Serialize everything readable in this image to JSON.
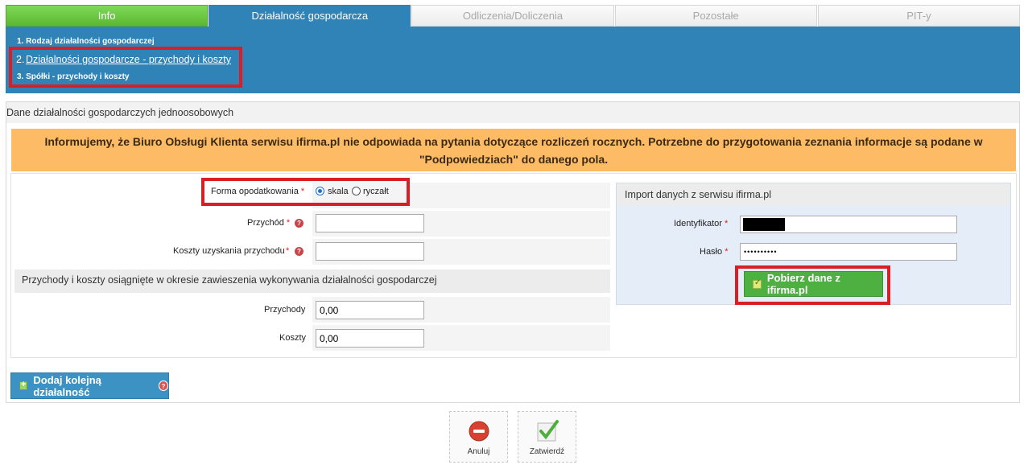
{
  "tabs": [
    "Info",
    "Działalność gospodarcza",
    "Odliczenia/Doliczenia",
    "Pozostałe",
    "PIT-y"
  ],
  "steps": {
    "s1": "1. Rodzaj działalności gospodarczej",
    "s2_num": "2.",
    "s2": "Działalności gospodarcze - przychody i koszty",
    "s3": "3. Spółki - przychody i koszty"
  },
  "panel_title": "Dane działalności gospodarczych jednoosobowych",
  "notice": "Informujemy, że Biuro Obsługi Klienta serwisu ifirma.pl nie odpowiada na pytania dotyczące rozliczeń rocznych. Potrzebne do przygotowania zeznania informacje są podane w \"Podpowiedziach\" do danego pola.",
  "form": {
    "tax_label": "Forma opodatkowania",
    "req": "*",
    "opt_skala": "skala",
    "opt_ryczalt": "ryczałt",
    "selected": "skala",
    "income_label": "Przychód",
    "income_value": "",
    "costs_label": "Koszty uzyskania przychodu",
    "costs_value": "",
    "help": "?"
  },
  "suspension": {
    "title": "Przychody i koszty osiągnięte w okresie zawieszenia wykonywania działalności gospodarczej",
    "income_label": "Przychody",
    "income_value": "0,00",
    "costs_label": "Koszty",
    "costs_value": "0,00"
  },
  "import": {
    "title": "Import danych z serwisu ifirma.pl",
    "id_label": "Identyfikator",
    "password_label": "Hasło",
    "password_value": "••••••••••",
    "button": "Pobierz dane z ifirma.pl"
  },
  "add_button": "Dodaj kolejną działalność",
  "actions": {
    "cancel": "Anuluj",
    "confirm": "Zatwierdź"
  },
  "colors": {
    "info_tab": "#6cc944",
    "active_tab": "#2f83b6",
    "notice": "#fdbb66",
    "highlight": "#d81f26"
  }
}
